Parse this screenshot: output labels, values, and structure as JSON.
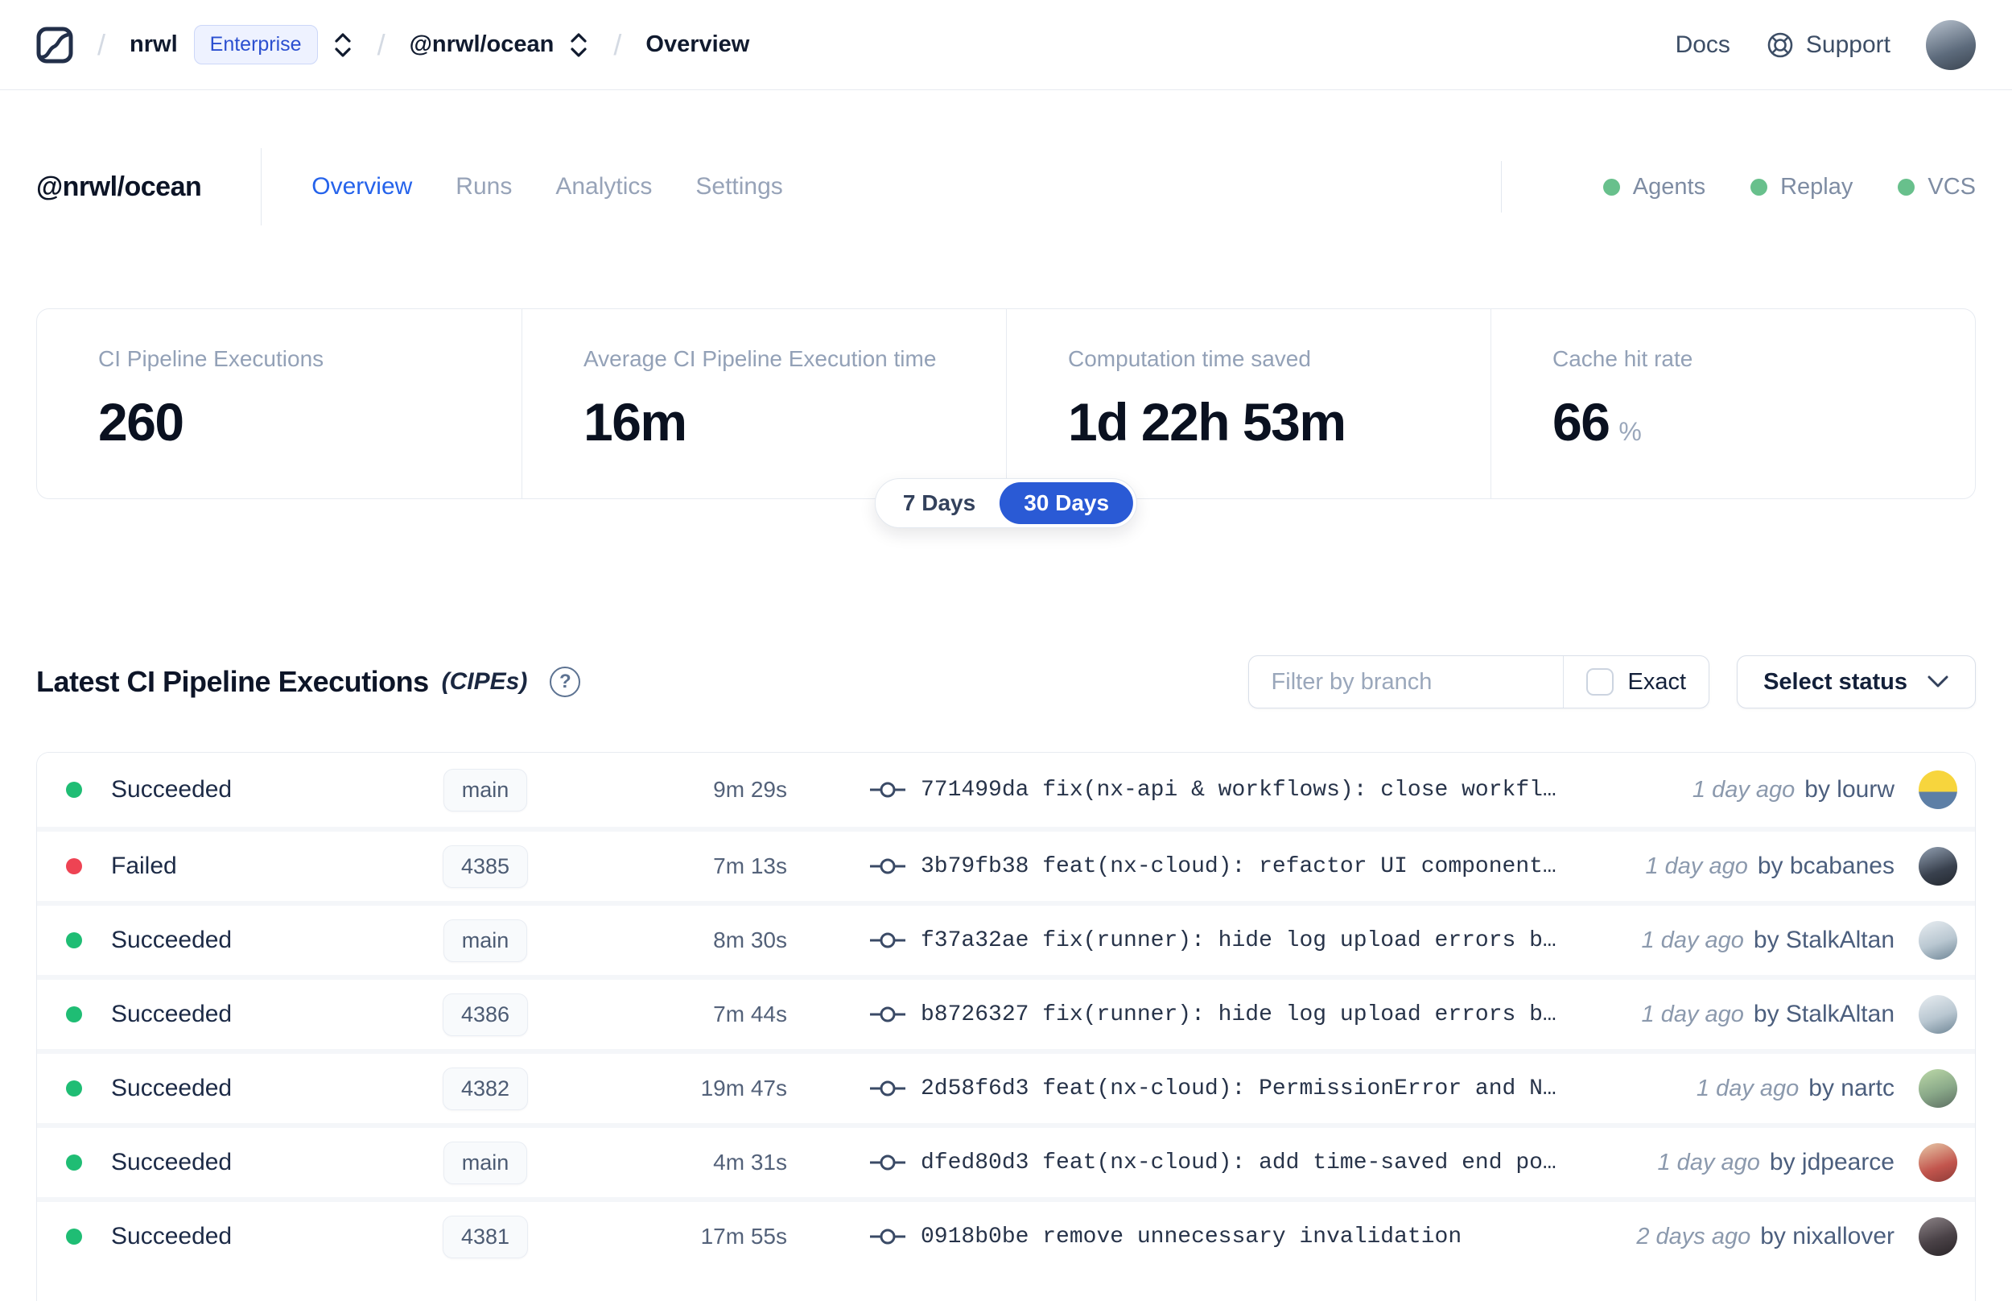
{
  "nav": {
    "breadcrumb": {
      "org": "nrwl",
      "org_badge": "Enterprise",
      "workspace": "@nrwl/ocean",
      "page": "Overview",
      "separator": "/"
    },
    "docs_label": "Docs",
    "support_label": "Support",
    "user_avatar_style": "background:linear-gradient(160deg,#b9c3cf 0%,#5d6b7c 60%,#39434f 100%)"
  },
  "header": {
    "workspace_name": "@nrwl/ocean",
    "tabs": [
      {
        "label": "Overview",
        "active": true
      },
      {
        "label": "Runs",
        "active": false
      },
      {
        "label": "Analytics",
        "active": false
      },
      {
        "label": "Settings",
        "active": false
      }
    ],
    "features": [
      {
        "label": "Agents",
        "status_color": "#68c08c"
      },
      {
        "label": "Replay",
        "status_color": "#68c08c"
      },
      {
        "label": "VCS",
        "status_color": "#68c08c"
      }
    ]
  },
  "stats": {
    "cards": [
      {
        "label": "CI Pipeline Executions",
        "value": "260",
        "suffix": ""
      },
      {
        "label": "Average CI Pipeline Execution time",
        "value": "16m",
        "suffix": ""
      },
      {
        "label": "Computation time saved",
        "value": "1d 22h 53m",
        "suffix": ""
      },
      {
        "label": "Cache hit rate",
        "value": "66",
        "suffix": "%"
      }
    ],
    "range_toggle": {
      "options": [
        "7 Days",
        "30 Days"
      ],
      "selected": "30 Days",
      "active_color": "#2a5ad5"
    }
  },
  "section": {
    "title": "Latest CI Pipeline Executions",
    "subtitle": "(CIPEs)",
    "help_glyph": "?",
    "filter": {
      "placeholder": "Filter by branch",
      "exact_label": "Exact",
      "status_label": "Select status"
    }
  },
  "table": {
    "rows": [
      {
        "status": "Succeeded",
        "dot_style": "background:#1fbd74",
        "branch": "main",
        "duration": "9m 29s",
        "commit_hash": "771499da",
        "commit_message": "fix(nx-api & workflows): close workfl…",
        "time_ago": "1 day ago",
        "author": "by lourw",
        "avatar_style": "background:linear-gradient(180deg,#f7d53d 55%,#5d7fa6 55%)"
      },
      {
        "status": "Failed",
        "dot_style": "background:#ee4353",
        "branch": "4385",
        "duration": "7m 13s",
        "commit_hash": "3b79fb38",
        "commit_message": "feat(nx-cloud): refactor UI component…",
        "time_ago": "1 day ago",
        "author": "by bcabanes",
        "avatar_style": "background:linear-gradient(160deg,#93a1b3 0%,#39414e 60%,#23282f 100%)"
      },
      {
        "status": "Succeeded",
        "dot_style": "background:#1fbd74",
        "branch": "main",
        "duration": "8m 30s",
        "commit_hash": "f37a32ae",
        "commit_message": "fix(runner): hide log upload errors b…",
        "time_ago": "1 day ago",
        "author": "by StalkAltan",
        "avatar_style": "background:linear-gradient(160deg,#e8edf1 0%,#b9c7d1 55%,#6f8696 100%)"
      },
      {
        "status": "Succeeded",
        "dot_style": "background:#1fbd74",
        "branch": "4386",
        "duration": "7m 44s",
        "commit_hash": "b8726327",
        "commit_message": "fix(runner): hide log upload errors b…",
        "time_ago": "1 day ago",
        "author": "by StalkAltan",
        "avatar_style": "background:linear-gradient(160deg,#e8edf1 0%,#b9c7d1 55%,#6f8696 100%)"
      },
      {
        "status": "Succeeded",
        "dot_style": "background:#1fbd74",
        "branch": "4382",
        "duration": "19m 47s",
        "commit_hash": "2d58f6d3",
        "commit_message": "feat(nx-cloud): PermissionError and N…",
        "time_ago": "1 day ago",
        "author": "by nartc",
        "avatar_style": "background:linear-gradient(160deg,#bcd9a8 0%,#8aa989 55%,#5c6e62 100%)"
      },
      {
        "status": "Succeeded",
        "dot_style": "background:#1fbd74",
        "branch": "main",
        "duration": "4m 31s",
        "commit_hash": "dfed80d3",
        "commit_message": "feat(nx-cloud): add time-saved end po…",
        "time_ago": "1 day ago",
        "author": "by jdpearce",
        "avatar_style": "background:linear-gradient(160deg,#e7c9a8 0%,#c2554d 60%,#8e3c38 100%)"
      },
      {
        "status": "Succeeded",
        "dot_style": "background:#1fbd74",
        "branch": "4381",
        "duration": "17m 55s",
        "commit_hash": "0918b0be",
        "commit_message": "remove unnecessary invalidation",
        "time_ago": "2 days ago",
        "author": "by nixallover",
        "avatar_style": "background:linear-gradient(160deg,#8d8488 0%,#4a4247 55%,#2a2528 100%)"
      }
    ]
  },
  "colors": {
    "accent_blue": "#2563eb",
    "toggle_blue": "#2a5ad5",
    "success_green": "#1fbd74",
    "failed_red": "#ee4353",
    "feature_green": "#68c08c"
  }
}
